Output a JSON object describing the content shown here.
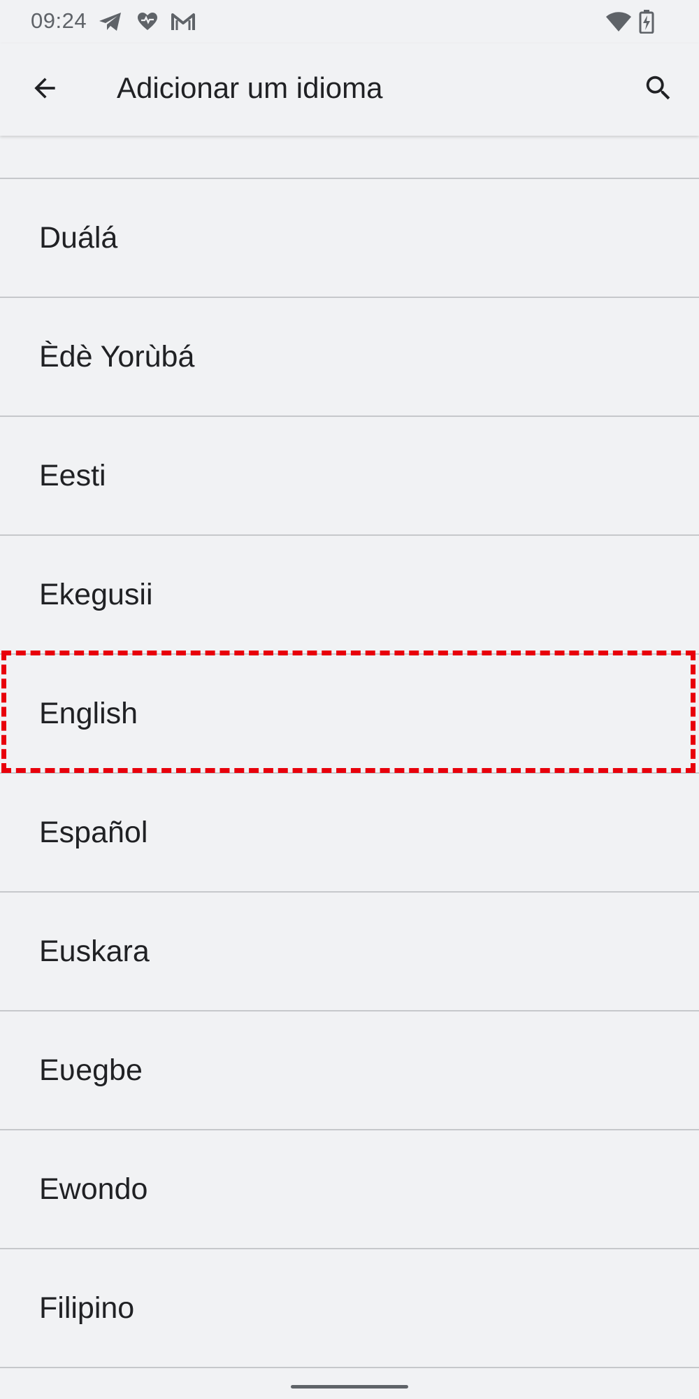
{
  "status_bar": {
    "time": "09:24",
    "icons": [
      "telegram-icon",
      "health-icon",
      "gmail-icon",
      "wifi-icon",
      "battery-charging-icon"
    ]
  },
  "app_bar": {
    "title": "Adicionar um idioma",
    "back_icon": "arrow-back-icon",
    "search_icon": "search-icon"
  },
  "languages": [
    {
      "label": "Duálá"
    },
    {
      "label": "Èdè Yorùbá"
    },
    {
      "label": "Eesti"
    },
    {
      "label": "Ekegusii"
    },
    {
      "label": "English",
      "highlighted": true
    },
    {
      "label": "Español"
    },
    {
      "label": "Euskara"
    },
    {
      "label": "Eʋegbe"
    },
    {
      "label": "Ewondo"
    },
    {
      "label": "Filipino"
    }
  ],
  "colors": {
    "background": "#f1f2f4",
    "divider": "#c6c8cb",
    "text": "#202124",
    "highlight": "#e8000b"
  }
}
